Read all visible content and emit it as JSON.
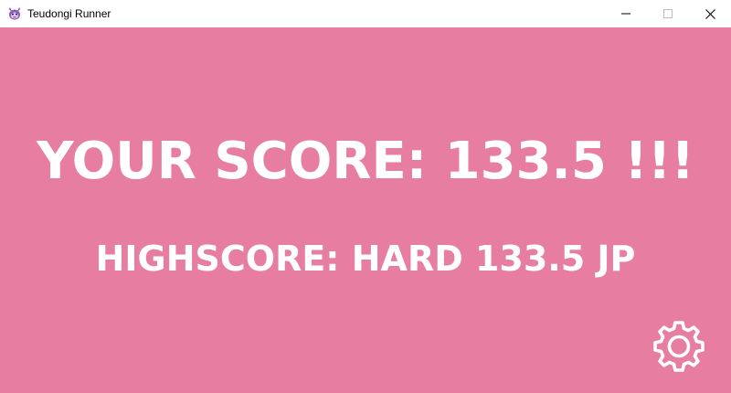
{
  "window": {
    "title": "Teudongi Runner",
    "app_icon": "teudongi-character-icon",
    "controls": {
      "minimize_icon": "minimize-icon",
      "maximize_icon": "maximize-icon",
      "close_icon": "close-icon"
    }
  },
  "game": {
    "background_color": "#e77ea2",
    "text_color": "#ffffff",
    "your_score_text": "YOUR SCORE: 133.5 !!!",
    "highscore_text": "HIGHSCORE: HARD 133.5 JP",
    "settings_icon": "gear-icon"
  }
}
